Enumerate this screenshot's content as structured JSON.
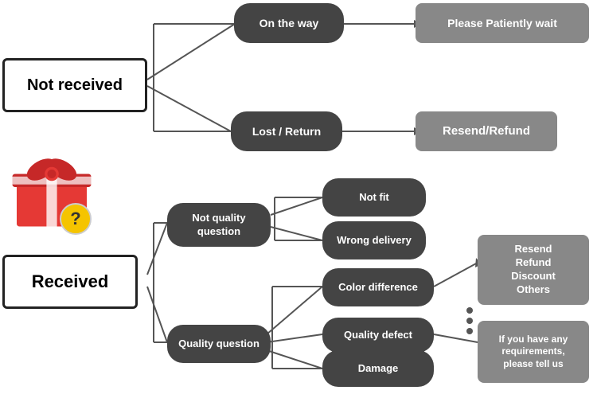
{
  "nodes": {
    "not_received": {
      "label": "Not received"
    },
    "on_the_way": {
      "label": "On the way"
    },
    "please_wait": {
      "label": "Please Patiently wait"
    },
    "lost_return": {
      "label": "Lost / Return"
    },
    "resend_refund_1": {
      "label": "Resend/Refund"
    },
    "received": {
      "label": "Received"
    },
    "not_quality": {
      "label": "Not quality\nquestion"
    },
    "quality_question": {
      "label": "Quality question"
    },
    "not_fit": {
      "label": "Not fit"
    },
    "wrong_delivery": {
      "label": "Wrong delivery"
    },
    "color_difference": {
      "label": "Color difference"
    },
    "quality_defect": {
      "label": "Quality defect"
    },
    "damage": {
      "label": "Damage"
    },
    "resend_refund_2": {
      "label": "Resend\nRefund\nDiscount\nOthers"
    },
    "if_requirements": {
      "label": "If you have any\nrequirements,\nplease tell us"
    }
  }
}
